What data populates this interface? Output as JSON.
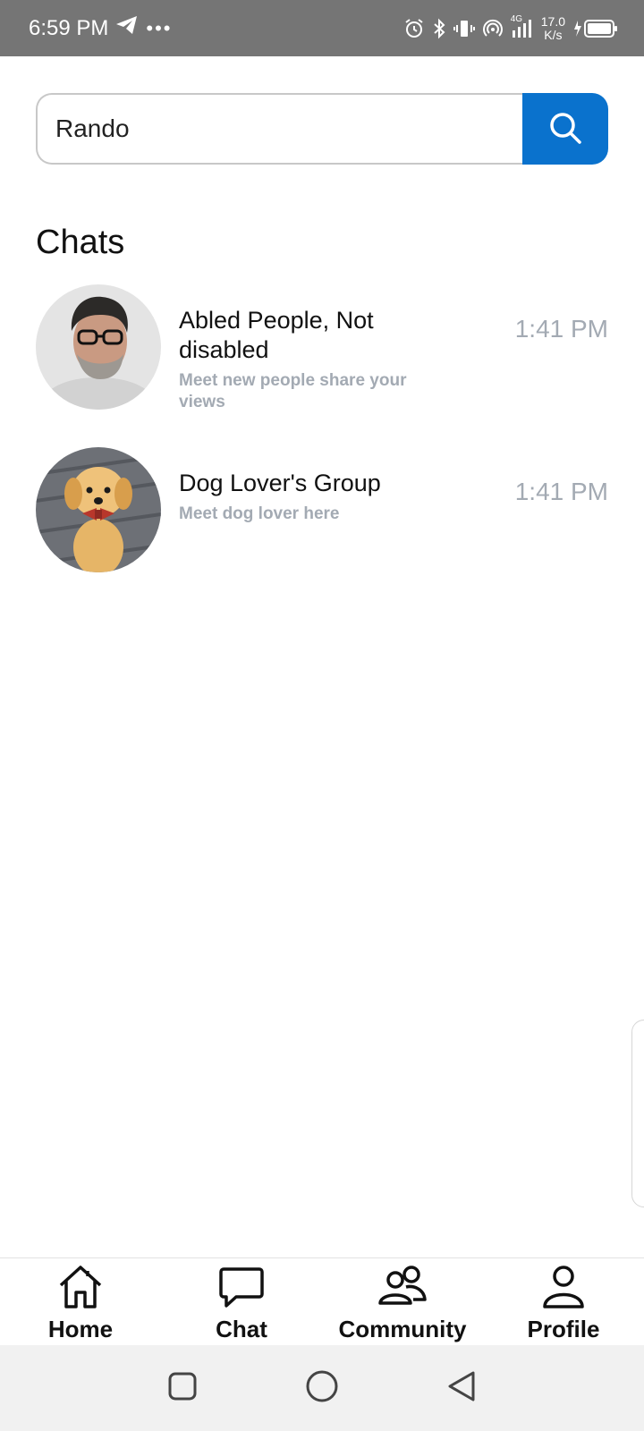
{
  "status_bar": {
    "time": "6:59 PM",
    "more": "•••",
    "network_type": "4G",
    "speed_value": "17.0",
    "speed_unit": "K/s"
  },
  "search": {
    "value": "Rando",
    "placeholder": ""
  },
  "section_title": "Chats",
  "chats": [
    {
      "name": "Abled People, Not disabled",
      "description": "Meet new people share your views",
      "time": "1:41 PM",
      "avatar": "man-with-glasses-photo"
    },
    {
      "name": "Dog Lover's Group",
      "description": "Meet dog lover here",
      "time": "1:41 PM",
      "avatar": "golden-retriever-puppy-photo"
    }
  ],
  "nav": {
    "home": "Home",
    "chat": "Chat",
    "community": "Community",
    "profile": "Profile"
  },
  "colors": {
    "accent": "#0a72cd",
    "status_bar": "#757575",
    "muted_text": "#a3aab3"
  }
}
